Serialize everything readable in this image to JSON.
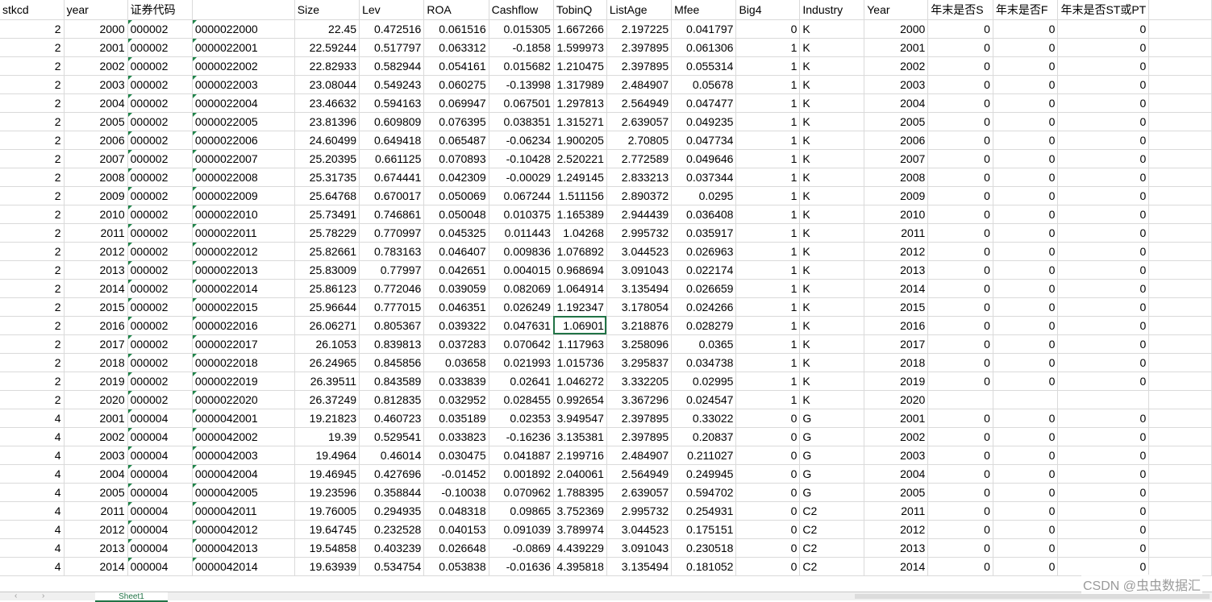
{
  "headers": [
    "stkcd",
    "year",
    "证券代码",
    "",
    "Size",
    "Lev",
    "ROA",
    "Cashflow",
    "TobinQ",
    "ListAge",
    "Mfee",
    "Big4",
    "Industry",
    "Year",
    "年末是否S",
    "年末是否F",
    "年末是否ST或PT",
    ""
  ],
  "rows": [
    [
      "2",
      "2000",
      "000002",
      "0000022000",
      "22.45",
      "0.472516",
      "0.061516",
      "0.015305",
      "1.667266",
      "2.197225",
      "0.041797",
      "0",
      "K",
      "2000",
      "0",
      "0",
      "0"
    ],
    [
      "2",
      "2001",
      "000002",
      "0000022001",
      "22.59244",
      "0.517797",
      "0.063312",
      "-0.1858",
      "1.599973",
      "2.397895",
      "0.061306",
      "1",
      "K",
      "2001",
      "0",
      "0",
      "0"
    ],
    [
      "2",
      "2002",
      "000002",
      "0000022002",
      "22.82933",
      "0.582944",
      "0.054161",
      "0.015682",
      "1.210475",
      "2.397895",
      "0.055314",
      "1",
      "K",
      "2002",
      "0",
      "0",
      "0"
    ],
    [
      "2",
      "2003",
      "000002",
      "0000022003",
      "23.08044",
      "0.549243",
      "0.060275",
      "-0.13998",
      "1.317989",
      "2.484907",
      "0.05678",
      "1",
      "K",
      "2003",
      "0",
      "0",
      "0"
    ],
    [
      "2",
      "2004",
      "000002",
      "0000022004",
      "23.46632",
      "0.594163",
      "0.069947",
      "0.067501",
      "1.297813",
      "2.564949",
      "0.047477",
      "1",
      "K",
      "2004",
      "0",
      "0",
      "0"
    ],
    [
      "2",
      "2005",
      "000002",
      "0000022005",
      "23.81396",
      "0.609809",
      "0.076395",
      "0.038351",
      "1.315271",
      "2.639057",
      "0.049235",
      "1",
      "K",
      "2005",
      "0",
      "0",
      "0"
    ],
    [
      "2",
      "2006",
      "000002",
      "0000022006",
      "24.60499",
      "0.649418",
      "0.065487",
      "-0.06234",
      "1.900205",
      "2.70805",
      "0.047734",
      "1",
      "K",
      "2006",
      "0",
      "0",
      "0"
    ],
    [
      "2",
      "2007",
      "000002",
      "0000022007",
      "25.20395",
      "0.661125",
      "0.070893",
      "-0.10428",
      "2.520221",
      "2.772589",
      "0.049646",
      "1",
      "K",
      "2007",
      "0",
      "0",
      "0"
    ],
    [
      "2",
      "2008",
      "000002",
      "0000022008",
      "25.31735",
      "0.674441",
      "0.042309",
      "-0.00029",
      "1.249145",
      "2.833213",
      "0.037344",
      "1",
      "K",
      "2008",
      "0",
      "0",
      "0"
    ],
    [
      "2",
      "2009",
      "000002",
      "0000022009",
      "25.64768",
      "0.670017",
      "0.050069",
      "0.067244",
      "1.511156",
      "2.890372",
      "0.0295",
      "1",
      "K",
      "2009",
      "0",
      "0",
      "0"
    ],
    [
      "2",
      "2010",
      "000002",
      "0000022010",
      "25.73491",
      "0.746861",
      "0.050048",
      "0.010375",
      "1.165389",
      "2.944439",
      "0.036408",
      "1",
      "K",
      "2010",
      "0",
      "0",
      "0"
    ],
    [
      "2",
      "2011",
      "000002",
      "0000022011",
      "25.78229",
      "0.770997",
      "0.045325",
      "0.011443",
      "1.04268",
      "2.995732",
      "0.035917",
      "1",
      "K",
      "2011",
      "0",
      "0",
      "0"
    ],
    [
      "2",
      "2012",
      "000002",
      "0000022012",
      "25.82661",
      "0.783163",
      "0.046407",
      "0.009836",
      "1.076892",
      "3.044523",
      "0.026963",
      "1",
      "K",
      "2012",
      "0",
      "0",
      "0"
    ],
    [
      "2",
      "2013",
      "000002",
      "0000022013",
      "25.83009",
      "0.77997",
      "0.042651",
      "0.004015",
      "0.968694",
      "3.091043",
      "0.022174",
      "1",
      "K",
      "2013",
      "0",
      "0",
      "0"
    ],
    [
      "2",
      "2014",
      "000002",
      "0000022014",
      "25.86123",
      "0.772046",
      "0.039059",
      "0.082069",
      "1.064914",
      "3.135494",
      "0.026659",
      "1",
      "K",
      "2014",
      "0",
      "0",
      "0"
    ],
    [
      "2",
      "2015",
      "000002",
      "0000022015",
      "25.96644",
      "0.777015",
      "0.046351",
      "0.026249",
      "1.192347",
      "3.178054",
      "0.024266",
      "1",
      "K",
      "2015",
      "0",
      "0",
      "0"
    ],
    [
      "2",
      "2016",
      "000002",
      "0000022016",
      "26.06271",
      "0.805367",
      "0.039322",
      "0.047631",
      "1.06901",
      "3.218876",
      "0.028279",
      "1",
      "K",
      "2016",
      "0",
      "0",
      "0"
    ],
    [
      "2",
      "2017",
      "000002",
      "0000022017",
      "26.1053",
      "0.839813",
      "0.037283",
      "0.070642",
      "1.117963",
      "3.258096",
      "0.0365",
      "1",
      "K",
      "2017",
      "0",
      "0",
      "0"
    ],
    [
      "2",
      "2018",
      "000002",
      "0000022018",
      "26.24965",
      "0.845856",
      "0.03658",
      "0.021993",
      "1.015736",
      "3.295837",
      "0.034738",
      "1",
      "K",
      "2018",
      "0",
      "0",
      "0"
    ],
    [
      "2",
      "2019",
      "000002",
      "0000022019",
      "26.39511",
      "0.843589",
      "0.033839",
      "0.02641",
      "1.046272",
      "3.332205",
      "0.02995",
      "1",
      "K",
      "2019",
      "0",
      "0",
      "0"
    ],
    [
      "2",
      "2020",
      "000002",
      "0000022020",
      "26.37249",
      "0.812835",
      "0.032952",
      "0.028455",
      "0.992654",
      "3.367296",
      "0.024547",
      "1",
      "K",
      "2020",
      "",
      "",
      ""
    ],
    [
      "4",
      "2001",
      "000004",
      "0000042001",
      "19.21823",
      "0.460723",
      "0.035189",
      "0.02353",
      "3.949547",
      "2.397895",
      "0.33022",
      "0",
      "G",
      "2001",
      "0",
      "0",
      "0"
    ],
    [
      "4",
      "2002",
      "000004",
      "0000042002",
      "19.39",
      "0.529541",
      "0.033823",
      "-0.16236",
      "3.135381",
      "2.397895",
      "0.20837",
      "0",
      "G",
      "2002",
      "0",
      "0",
      "0"
    ],
    [
      "4",
      "2003",
      "000004",
      "0000042003",
      "19.4964",
      "0.46014",
      "0.030475",
      "0.041887",
      "2.199716",
      "2.484907",
      "0.211027",
      "0",
      "G",
      "2003",
      "0",
      "0",
      "0"
    ],
    [
      "4",
      "2004",
      "000004",
      "0000042004",
      "19.46945",
      "0.427696",
      "-0.01452",
      "0.001892",
      "2.040061",
      "2.564949",
      "0.249945",
      "0",
      "G",
      "2004",
      "0",
      "0",
      "0"
    ],
    [
      "4",
      "2005",
      "000004",
      "0000042005",
      "19.23596",
      "0.358844",
      "-0.10038",
      "0.070962",
      "1.788395",
      "2.639057",
      "0.594702",
      "0",
      "G",
      "2005",
      "0",
      "0",
      "0"
    ],
    [
      "4",
      "2011",
      "000004",
      "0000042011",
      "19.76005",
      "0.294935",
      "0.048318",
      "0.09865",
      "3.752369",
      "2.995732",
      "0.254931",
      "0",
      "C2",
      "2011",
      "0",
      "0",
      "0"
    ],
    [
      "4",
      "2012",
      "000004",
      "0000042012",
      "19.64745",
      "0.232528",
      "0.040153",
      "0.091039",
      "3.789974",
      "3.044523",
      "0.175151",
      "0",
      "C2",
      "2012",
      "0",
      "0",
      "0"
    ],
    [
      "4",
      "2013",
      "000004",
      "0000042013",
      "19.54858",
      "0.403239",
      "0.026648",
      "-0.0869",
      "4.439229",
      "3.091043",
      "0.230518",
      "0",
      "C2",
      "2013",
      "0",
      "0",
      "0"
    ],
    [
      "4",
      "2014",
      "000004",
      "0000042014",
      "19.63939",
      "0.534754",
      "0.053838",
      "-0.01636",
      "4.395818",
      "3.135494",
      "0.181052",
      "0",
      "C2",
      "2014",
      "0",
      "0",
      "0"
    ]
  ],
  "selected_cell": {
    "row": 16,
    "col": 8
  },
  "sheet_tab": "Sheet1",
  "watermark": "CSDN @虫虫数据汇",
  "colors": {
    "grid": "#dadada",
    "selection": "#217346",
    "text_marker": "#1e8449"
  }
}
